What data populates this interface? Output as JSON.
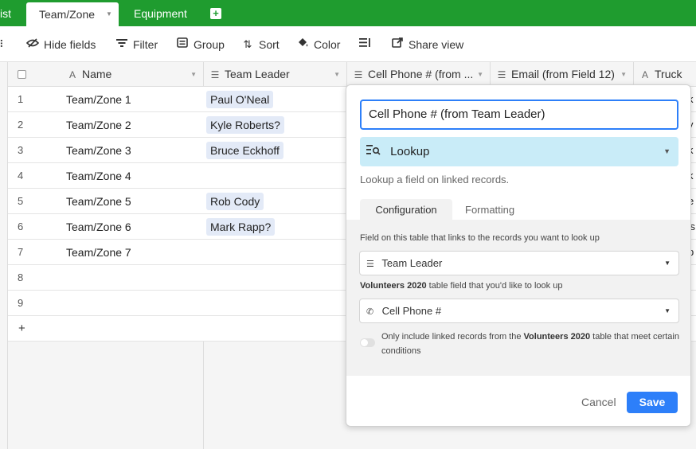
{
  "tabs": {
    "prev_label": "ist",
    "active_label": "Team/Zone",
    "next_label": "Equipment",
    "add_glyph": "+"
  },
  "toolbar": {
    "hide_fields": "Hide fields",
    "filter": "Filter",
    "group": "Group",
    "sort": "Sort",
    "color": "Color",
    "share_view": "Share view"
  },
  "columns": {
    "name": "Name",
    "team_leader": "Team Leader",
    "cell_phone": "Cell Phone # (from ...",
    "email": "Email (from Field 12)",
    "truck": "Truck"
  },
  "rows": [
    {
      "num": "1",
      "name": "Team/Zone 1",
      "leader": "Paul O'Neal",
      "edge": "k"
    },
    {
      "num": "2",
      "name": "Team/Zone 2",
      "leader": "Kyle Roberts?",
      "edge": "y"
    },
    {
      "num": "3",
      "name": "Team/Zone 3",
      "leader": "Bruce Eckhoff",
      "edge": "k"
    },
    {
      "num": "4",
      "name": "Team/Zone 4",
      "leader": "",
      "edge": "k"
    },
    {
      "num": "5",
      "name": "Team/Zone 5",
      "leader": "Rob Cody",
      "edge": "e"
    },
    {
      "num": "6",
      "name": "Team/Zone 6",
      "leader": "Mark Rapp?",
      "edge": "'s"
    },
    {
      "num": "7",
      "name": "Team/Zone 7",
      "leader": "",
      "edge": "p"
    },
    {
      "num": "8",
      "name": "",
      "leader": "",
      "edge": ""
    },
    {
      "num": "9",
      "name": "",
      "leader": "",
      "edge": ""
    }
  ],
  "add_row_glyph": "+",
  "popup": {
    "field_name": "Cell Phone # (from Team Leader)",
    "field_type": "Lookup",
    "description": "Lookup a field on linked records.",
    "tab_configuration": "Configuration",
    "tab_formatting": "Formatting",
    "link_label": "Field on this table that links to the records you want to look up",
    "link_value": "Team Leader",
    "lookup_label_table": "Volunteers 2020",
    "lookup_label_rest": " table field that you'd like to look up",
    "lookup_value": "Cell Phone #",
    "toggle_text_pre": "Only include linked records from the ",
    "toggle_text_table": "Volunteers 2020",
    "toggle_text_post": " table that meet certain conditions",
    "cancel": "Cancel",
    "save": "Save"
  },
  "colors": {
    "tabbar": "#1f9c2f",
    "primary": "#2d7ff9",
    "lookup_bg": "#c9ecf8",
    "chip_bg": "#e3eaf7"
  }
}
